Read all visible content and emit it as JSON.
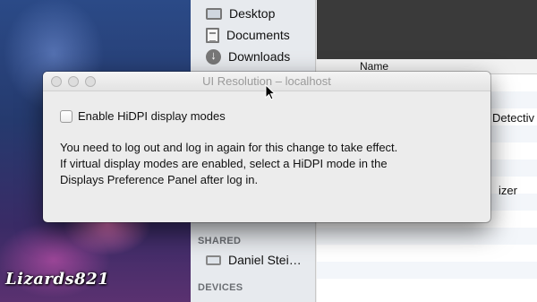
{
  "finder": {
    "sidebar": {
      "favorites": [
        {
          "label": "Desktop",
          "icon": "desktop-icon"
        },
        {
          "label": "Documents",
          "icon": "documents-icon"
        },
        {
          "label": "Downloads",
          "icon": "downloads-icon"
        }
      ],
      "shared_heading": "SHARED",
      "shared": [
        {
          "label": "Daniel Stei…",
          "icon": "computer-icon"
        }
      ],
      "devices_heading": "DEVICES"
    },
    "column_header": "Name",
    "rows": [
      "Detectiv",
      "izer"
    ]
  },
  "dialog": {
    "title": "UI Resolution – localhost",
    "checkbox_label": "Enable HiDPI display modes",
    "checkbox_checked": false,
    "message_line1": "You need to log out and log in again for this change to take effect.",
    "message_line2a": "If virtual display modes are enabled, select a HiDPI mode in the",
    "message_line2b": "Displays Preference Panel after log in."
  },
  "watermark": "Lizards821"
}
